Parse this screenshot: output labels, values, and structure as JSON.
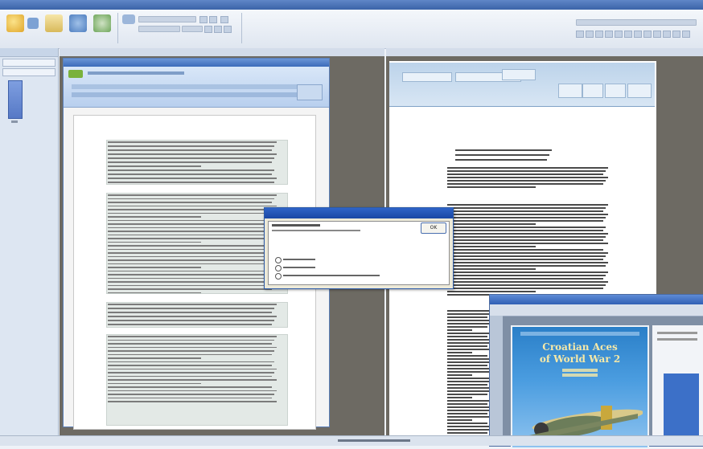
{
  "cover": {
    "title_line1": "Croatian Aces",
    "title_line2": "of World War 2"
  },
  "dialog": {
    "ok_label": "OK"
  },
  "colors": {
    "panel_gray": "#6d6a63",
    "ribbon_blue": "#3b64a8",
    "cover_blue": "#2a7fc8",
    "dialog_title": "#2f64c8"
  },
  "icons": {
    "app_logo": "pencil-icon",
    "open": "folder-icon",
    "save": "save-icon",
    "print": "printer-icon",
    "radio": "radio-button-icon"
  }
}
